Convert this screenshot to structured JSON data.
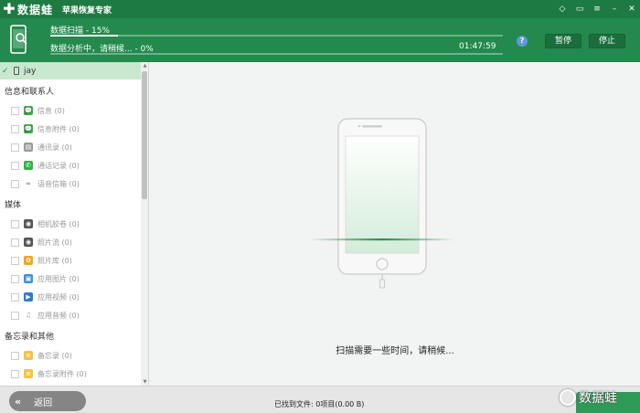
{
  "app": {
    "logo_text": "数据蛙",
    "name": "苹果恢复专家"
  },
  "window_controls": [
    "diamond-icon",
    "chat-icon",
    "menu-icon",
    "minimize-icon",
    "close-icon"
  ],
  "progress": {
    "scan_label": "数据扫描 - 15%",
    "scan_fraction": 0.15,
    "analyze_label": "数据分析中，请稍候... - 0%",
    "analyze_fraction": 0.0,
    "time": "01:47:59",
    "help": "?",
    "pause_label": "暂停",
    "stop_label": "停止"
  },
  "sidebar": {
    "device": "jay",
    "groups": [
      {
        "title": "信息和联系人",
        "items": [
          {
            "label": "信息 (0)",
            "icon": "message-icon",
            "color": "#2fb344"
          },
          {
            "label": "信息附件 (0)",
            "icon": "message-attachment-icon",
            "color": "#2fb344"
          },
          {
            "label": "通讯录 (0)",
            "icon": "contacts-icon",
            "color": "#9a9a9a"
          },
          {
            "label": "通话记录 (0)",
            "icon": "phone-icon",
            "color": "#2fb344"
          },
          {
            "label": "语音信箱 (0)",
            "icon": "voicemail-icon",
            "color": "#666666"
          }
        ]
      },
      {
        "title": "媒体",
        "items": [
          {
            "label": "相机胶卷 (0)",
            "icon": "camera-icon",
            "color": "#555555"
          },
          {
            "label": "照片流 (0)",
            "icon": "photostream-icon",
            "color": "#555555"
          },
          {
            "label": "照片库 (0)",
            "icon": "photos-icon",
            "color": "#f5a623"
          },
          {
            "label": "应用图片 (0)",
            "icon": "app-photos-icon",
            "color": "#3b8fe0"
          },
          {
            "label": "应用视频 (0)",
            "icon": "app-video-icon",
            "color": "#2a7bd8"
          },
          {
            "label": "应用音频 (0)",
            "icon": "app-audio-icon",
            "color": "#aaaaaa"
          }
        ]
      },
      {
        "title": "备忘录和其他",
        "items": [
          {
            "label": "备忘录 (0)",
            "icon": "notes-icon",
            "color": "#f5c242"
          },
          {
            "label": "备忘录附件 (0)",
            "icon": "notes-attachment-icon",
            "color": "#f5c242"
          }
        ]
      }
    ]
  },
  "main": {
    "scan_message": "扫描需要一些时间，请稍候..."
  },
  "footer": {
    "back_label": "返回",
    "found_text": "已找到文件: 0项目(0.00 B)",
    "watermark": "数据蛙"
  }
}
